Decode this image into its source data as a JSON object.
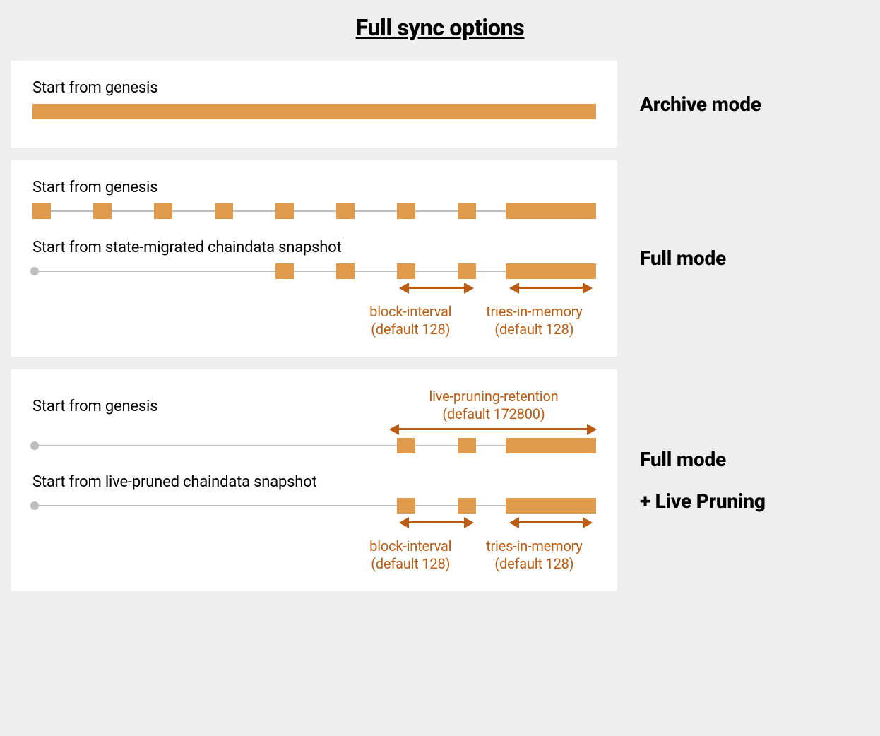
{
  "title": "Full sync options",
  "colors": {
    "bar": "#df9a4c",
    "arrow": "#bc5c12",
    "line": "#bdbdbd"
  },
  "rows": [
    {
      "side_label": "Archive mode",
      "sections": [
        {
          "subtitle": "Start from genesis",
          "kind": "solid"
        }
      ]
    },
    {
      "side_label": "Full mode",
      "sections": [
        {
          "subtitle": "Start from genesis",
          "kind": "blocks8"
        },
        {
          "subtitle": "Start from state-migrated chaindata snapshot",
          "kind": "dot_blocks4",
          "below_annotations": [
            {
              "label1": "block-interval",
              "label2": "(default 128)"
            },
            {
              "label1": "tries-in-memory",
              "label2": "(default 128)"
            }
          ]
        }
      ]
    },
    {
      "side_label_line1": "Full mode",
      "side_label_line2": "+ Live Pruning",
      "sections": [
        {
          "top_annotation": {
            "label1": "live-pruning-retention",
            "label2": "(default 172800)"
          },
          "subtitle": "Start from genesis",
          "kind": "dot_blocks2_live"
        },
        {
          "subtitle": "Start from live-pruned chaindata snapshot",
          "kind": "dot_blocks2",
          "below_annotations": [
            {
              "label1": "block-interval",
              "label2": "(default 128)"
            },
            {
              "label1": "tries-in-memory",
              "label2": "(default 128)"
            }
          ]
        }
      ]
    }
  ]
}
